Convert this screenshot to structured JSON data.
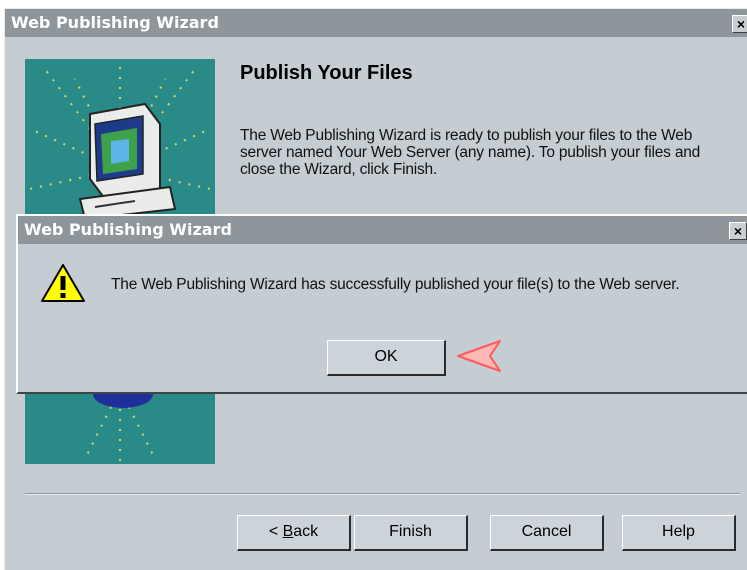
{
  "wizard": {
    "title": "Web Publishing Wizard",
    "close_glyph": "×",
    "heading": "Publish Your Files",
    "description": "The Web Publishing Wizard is ready to publish your files to the Web server named Your Web Server (any name). To publish your files and close the Wizard, click Finish.",
    "buttons": {
      "back_prefix": "< ",
      "back_accel": "B",
      "back_rest": "ack",
      "finish": "Finish",
      "cancel": "Cancel",
      "help": "Help"
    }
  },
  "dialog": {
    "title": "Web Publishing Wizard",
    "close_glyph": "×",
    "message": "The Web Publishing Wizard has successfully published your file(s) to the Web server.",
    "ok_label": "OK",
    "icon": "warning-icon"
  },
  "annotation": {
    "icon": "red-arrow-pointer",
    "color": "#ff7070"
  },
  "colors": {
    "titlebar": "#8e959b",
    "window": "#c5cdd3",
    "illustration": "#2a8a88"
  }
}
